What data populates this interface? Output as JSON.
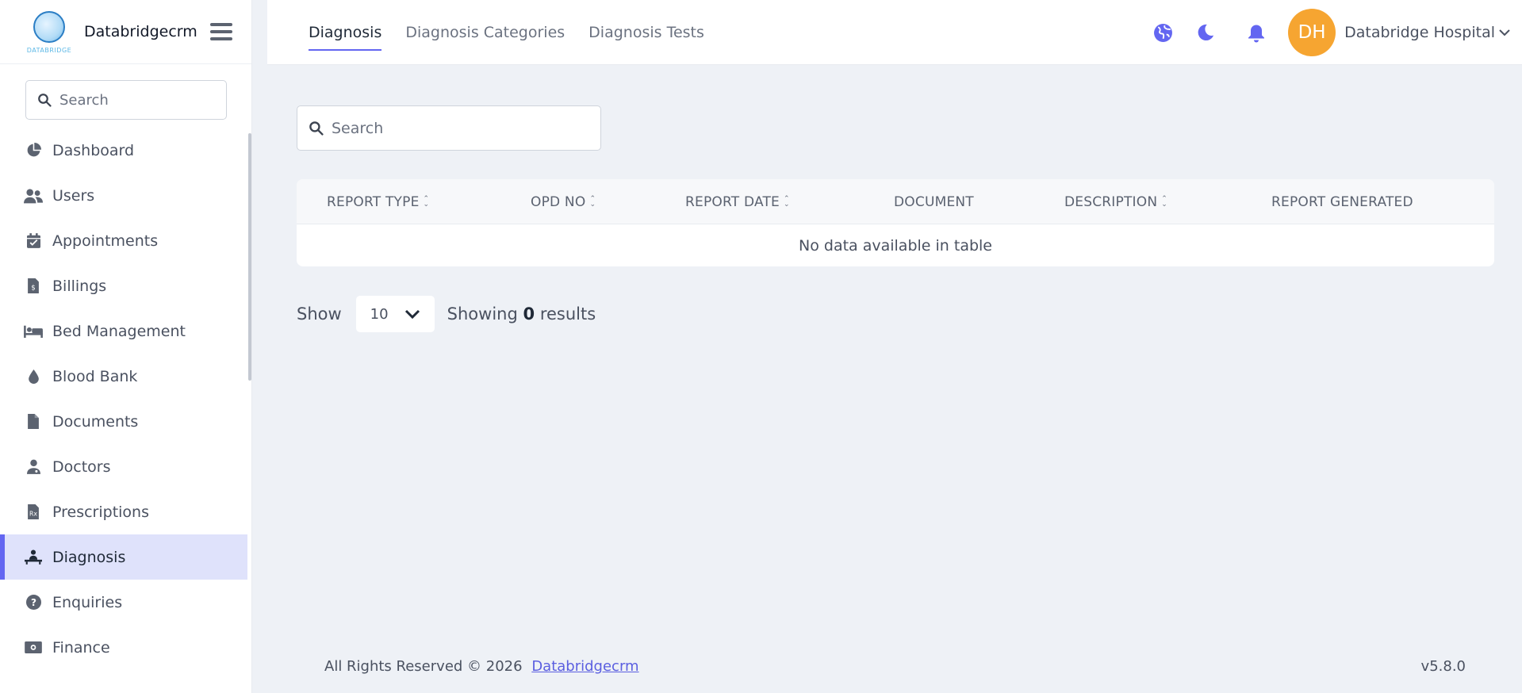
{
  "brand": {
    "name": "Databridgecrm",
    "logo_text": "DATABRIDGE"
  },
  "sidebar": {
    "search_placeholder": "Search",
    "items": [
      {
        "label": "Dashboard",
        "icon": "pie-chart-icon"
      },
      {
        "label": "Users",
        "icon": "users-icon"
      },
      {
        "label": "Appointments",
        "icon": "calendar-check-icon"
      },
      {
        "label": "Billings",
        "icon": "invoice-dollar-icon"
      },
      {
        "label": "Bed Management",
        "icon": "bed-icon"
      },
      {
        "label": "Blood Bank",
        "icon": "blood-drop-icon"
      },
      {
        "label": "Documents",
        "icon": "document-icon"
      },
      {
        "label": "Doctors",
        "icon": "doctor-icon"
      },
      {
        "label": "Prescriptions",
        "icon": "prescription-icon"
      },
      {
        "label": "Diagnosis",
        "icon": "patient-bed-icon",
        "active": true
      },
      {
        "label": "Enquiries",
        "icon": "question-circle-icon"
      },
      {
        "label": "Finance",
        "icon": "money-bill-icon"
      }
    ]
  },
  "header": {
    "tabs": [
      {
        "label": "Diagnosis",
        "active": true
      },
      {
        "label": "Diagnosis Categories"
      },
      {
        "label": "Diagnosis Tests"
      }
    ],
    "avatar_initials": "DH",
    "user_name": "Databridge Hospital",
    "accent_color": "#6366f1",
    "avatar_color": "#f6a531"
  },
  "main": {
    "search_placeholder": "Search",
    "table": {
      "columns": [
        {
          "label": "REPORT TYPE",
          "sortable": true
        },
        {
          "label": "OPD NO",
          "sortable": true
        },
        {
          "label": "REPORT DATE",
          "sortable": true
        },
        {
          "label": "DOCUMENT",
          "sortable": false
        },
        {
          "label": "DESCRIPTION",
          "sortable": true
        },
        {
          "label": "REPORT GENERATED",
          "sortable": false
        }
      ],
      "empty_message": "No data available in table"
    },
    "pager": {
      "show_label": "Show",
      "page_size": "10",
      "showing_prefix": "Showing",
      "showing_count": "0",
      "showing_suffix": "results"
    }
  },
  "footer": {
    "copyright": "All Rights Reserved © 2026",
    "link": "Databridgecrm",
    "version": "v5.8.0"
  }
}
